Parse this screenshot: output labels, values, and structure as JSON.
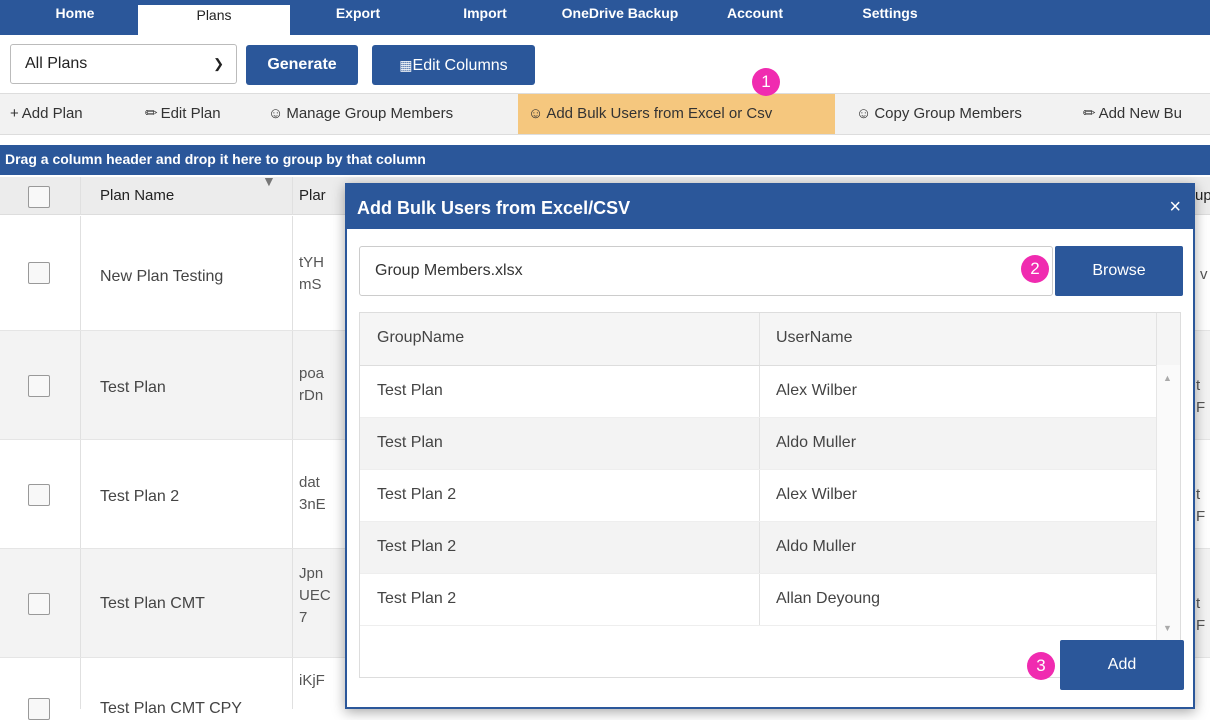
{
  "nav": {
    "tabs": [
      {
        "label": "Home"
      },
      {
        "label": "Plans"
      },
      {
        "label": "Export"
      },
      {
        "label": "Import"
      },
      {
        "label": "OneDrive Backup"
      },
      {
        "label": "Account"
      },
      {
        "label": "Settings"
      }
    ]
  },
  "controls": {
    "plan_select_value": "All Plans",
    "generate_label": "Generate",
    "edit_columns_label": "Edit Columns"
  },
  "toolbar": {
    "items": [
      {
        "label": "Add Plan",
        "icon": "plus-icon"
      },
      {
        "label": "Edit Plan",
        "icon": "pencil-icon"
      },
      {
        "label": "Manage Group Members",
        "icon": "users-add-icon"
      },
      {
        "label": "Add Bulk Users from Excel or Csv",
        "icon": "users-add-icon"
      },
      {
        "label": "Copy Group Members",
        "icon": "users-add-icon"
      },
      {
        "label": "Add New Bu",
        "icon": "pencil-icon"
      }
    ],
    "highlight_color": "#f5c77e"
  },
  "group_bar_text": "Drag a column header and drop it here to group by that column",
  "grid": {
    "headers": [
      "Plan Name",
      "Plar",
      "up"
    ],
    "rows": [
      {
        "name": "New Plan Testing",
        "id_part1": "tYH",
        "id_part2": "mS",
        "last": "v"
      },
      {
        "name": "Test Plan",
        "id_part1": "poa",
        "id_part2": "rDn",
        "last": "t F"
      },
      {
        "name": "Test Plan 2",
        "id_part1": "dat",
        "id_part2": "3nE",
        "last": "t F"
      },
      {
        "name": "Test Plan CMT",
        "id_part1": "Jpn",
        "id_part2": "UEC",
        "id_part3": "7",
        "last": "t F"
      },
      {
        "name": "Test Plan CMT CPY",
        "id_part1": "iKjF",
        "id_part2": "",
        "last": ""
      }
    ]
  },
  "modal": {
    "title": "Add Bulk Users from Excel/CSV",
    "close_glyph": "×",
    "file_value": "Group Members.xlsx",
    "browse_label": "Browse",
    "add_label": "Add",
    "columns": [
      "GroupName",
      "UserName"
    ],
    "rows": [
      {
        "group": "Test Plan",
        "user": "Alex Wilber"
      },
      {
        "group": "Test Plan",
        "user": "Aldo Muller"
      },
      {
        "group": "Test Plan 2",
        "user": "Alex Wilber"
      },
      {
        "group": "Test Plan 2",
        "user": "Aldo Muller"
      },
      {
        "group": "Test Plan 2",
        "user": "Allan Deyoung"
      }
    ]
  },
  "badges": [
    "1",
    "2",
    "3"
  ],
  "colors": {
    "brand": "#2b579a",
    "badge": "#f02bb0"
  }
}
